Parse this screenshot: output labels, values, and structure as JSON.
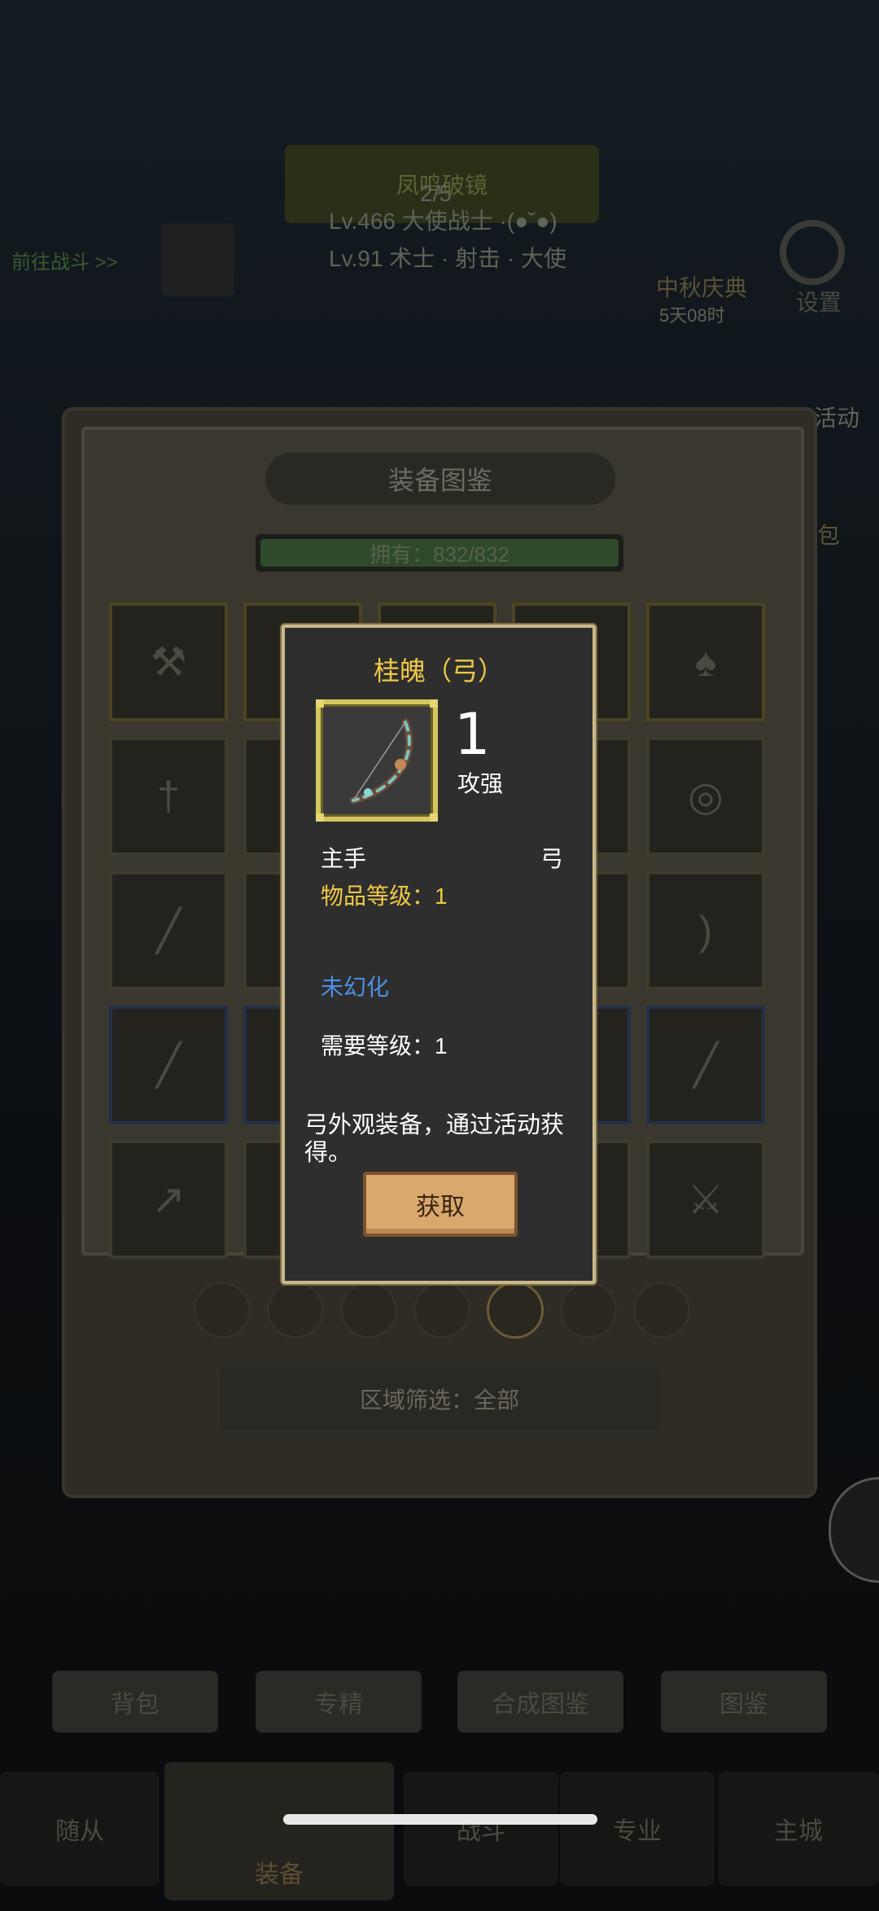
{
  "background": {
    "quest_title": "凤鸣破镜",
    "quest_progress": "2/5",
    "char_line1": "Lv.466 大使战士 ·(●˘●)",
    "char_line2": "Lv.91 术士 · 射击 · 大使",
    "left_link": "前往战斗 >>",
    "event_title": "中秋庆典",
    "event_timer": "5天08时",
    "settings_label": "设置",
    "activity_label": "活动",
    "bag_label": "包",
    "bottom_buttons": [
      "背包",
      "专精",
      "合成图鉴",
      "图鉴"
    ],
    "nav_tabs": [
      "随从",
      "装备",
      "战斗",
      "专业",
      "主城"
    ]
  },
  "panel": {
    "title": "装备图鉴",
    "owned_label": "拥有：832/832",
    "owned_fraction": 1.0,
    "region_filter": "区域筛选：全部"
  },
  "popup": {
    "title": "桂魄（弓）",
    "count": "1",
    "quality": "攻强",
    "slot_type": "主手",
    "weapon_type": "弓",
    "item_level": "物品等级：1",
    "illusion_status": "未幻化",
    "required_level": "需要等级：1",
    "description": "弓外观装备，通过活动获得。",
    "button_label": "获取"
  },
  "colors": {
    "gold_text": "#f0c846",
    "blue_text": "#4e8ee6",
    "popup_border": "#cbb98a",
    "button_bg": "#d9a86c"
  },
  "icons": {
    "grid": [
      "hammer-icon",
      "sword-icon",
      "sword-icon",
      "sword-icon",
      "mace-icon",
      "dagger-icon",
      "staff-icon",
      "staff-icon",
      "shield-icon",
      "shield-icon",
      "staff-icon",
      "staff-icon",
      "staff-icon",
      "bow-icon",
      "bow-icon",
      "staff-icon",
      "staff-icon",
      "staff-icon",
      "staff-icon",
      "staff-icon",
      "spear-icon",
      "spear-icon",
      "spear-icon",
      "spear-icon",
      "knife-icon"
    ]
  }
}
